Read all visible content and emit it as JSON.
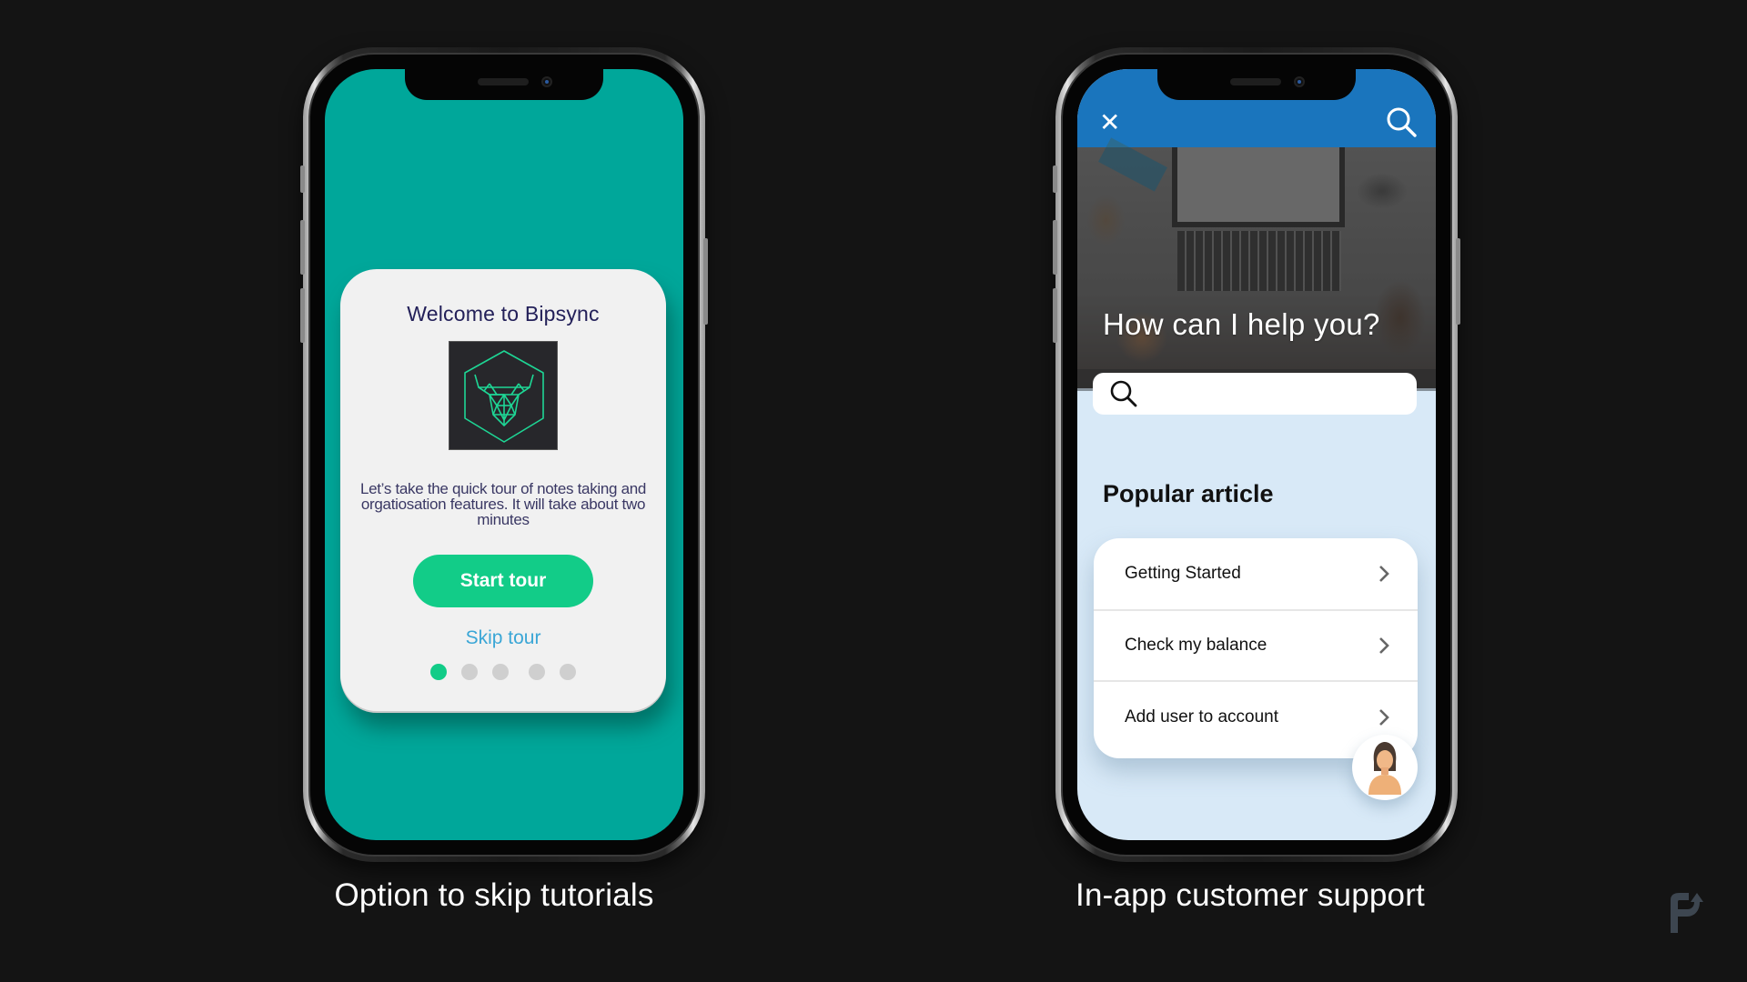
{
  "left_phone": {
    "caption": "Option to skip tutorials",
    "screen_bg": "#00a79a",
    "welcome_card": {
      "title": "Welcome to Bipsync",
      "logo_icon": "bull-head-hexagon-logo",
      "description": "Let’s take the quick tour of notes taking and orgatiosation features. It will take about two minutes",
      "start_button": "Start tour",
      "skip_link": "Skip tour",
      "pagination": {
        "total": 5,
        "active_index": 0
      },
      "accent_color": "#12cc88",
      "link_color": "#3aa6d6"
    }
  },
  "right_phone": {
    "caption": "In-app customer support",
    "topbar": {
      "close_icon": "close-icon",
      "search_icon": "search-icon",
      "color": "#1a75bd"
    },
    "hero": {
      "title": "How can I help you?",
      "search_placeholder": ""
    },
    "popular": {
      "title": "Popular article",
      "articles": [
        {
          "label": "Getting Started"
        },
        {
          "label": "Check my balance"
        },
        {
          "label": "Add user to account"
        }
      ]
    },
    "support_avatar_icon": "support-agent-avatar",
    "background_color": "#d8e9f7"
  },
  "brand_logo": "p-arrow-logo"
}
